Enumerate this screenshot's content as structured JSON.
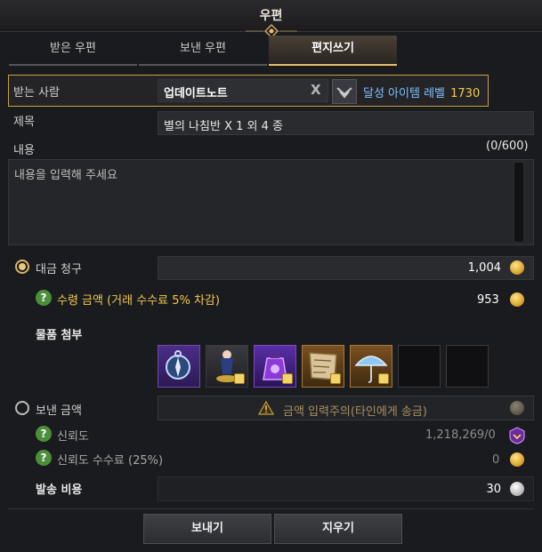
{
  "window": {
    "title": "우편"
  },
  "tabs": [
    {
      "label": "받은 우편"
    },
    {
      "label": "보낸 우편"
    },
    {
      "label": "편지쓰기"
    }
  ],
  "recipient": {
    "label": "받는 사람",
    "value": "업데이트노트",
    "clear_icon": "X",
    "achievement_label": "달성 아이템 레벨",
    "achievement_value": "1730"
  },
  "subject": {
    "label": "제목",
    "value": "별의 나침반 X 1 외 4 종"
  },
  "content": {
    "label": "내용",
    "counter": "(0/600)",
    "placeholder": "내용을 입력해 주세요"
  },
  "cod": {
    "label": "대금 청구",
    "value": "1,004",
    "receive_label": "수령 금액 (거래 수수료 5% 차감)",
    "receive_value": "953"
  },
  "attach": {
    "label": "물품 첨부",
    "items": [
      {
        "name": "star-compass",
        "color": "#5a3aa0"
      },
      {
        "name": "figurine",
        "color": "#3a3a3e"
      },
      {
        "name": "purple-potion",
        "color": "#5a3aa0"
      },
      {
        "name": "map-scroll",
        "color": "#8a5a20"
      },
      {
        "name": "umbrella",
        "color": "#8a5a20"
      }
    ]
  },
  "send_gold": {
    "label": "보낸 금액",
    "warning": "금액 입력주의(타인에게 송금)",
    "trust_label": "신뢰도",
    "trust_value": "1,218,269/0",
    "trust_fee_label": "신뢰도 수수료 (25%)",
    "trust_fee_value": "0"
  },
  "postage": {
    "label": "발송 비용",
    "value": "30"
  },
  "buttons": {
    "send": "보내기",
    "clear": "지우기"
  },
  "colors": {
    "accent_gold": "#e6c06a",
    "highlight_text": "#f2c94c",
    "achievement_text": "#7ec1ff"
  }
}
